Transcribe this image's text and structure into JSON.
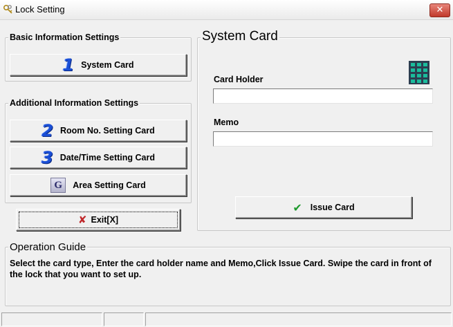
{
  "window": {
    "title": "Lock Setting",
    "close_glyph": "✕"
  },
  "basic_group": {
    "title": "Basic Information Settings"
  },
  "additional_group": {
    "title": "Additional Information Settings"
  },
  "buttons": {
    "system_card": {
      "label": "System Card",
      "icon": "1"
    },
    "room_no": {
      "label": "Room No. Setting Card",
      "icon": "2"
    },
    "datetime": {
      "label": "Date/Time Setting Card",
      "icon": "3"
    },
    "area": {
      "label": "Area Setting Card",
      "icon": "G"
    },
    "exit": {
      "label": "Exit[X]",
      "icon_glyph": "✘"
    },
    "issue": {
      "label": "Issue Card",
      "icon_glyph": "✔"
    }
  },
  "system_card_panel": {
    "title": "System Card",
    "card_holder_label": "Card Holder",
    "card_holder_value": "",
    "memo_label": "Memo",
    "memo_value": ""
  },
  "guide": {
    "title": "Operation Guide",
    "text": "Select the card type, Enter the card holder name and Memo,Click Issue Card. Swipe the card in front of the  lock that you want to set up."
  },
  "colors": {
    "number_icon": "#1a4fd6",
    "exit_icon": "#c0282b",
    "check_icon": "#1f9a2e",
    "close_button": "#c0392b"
  }
}
